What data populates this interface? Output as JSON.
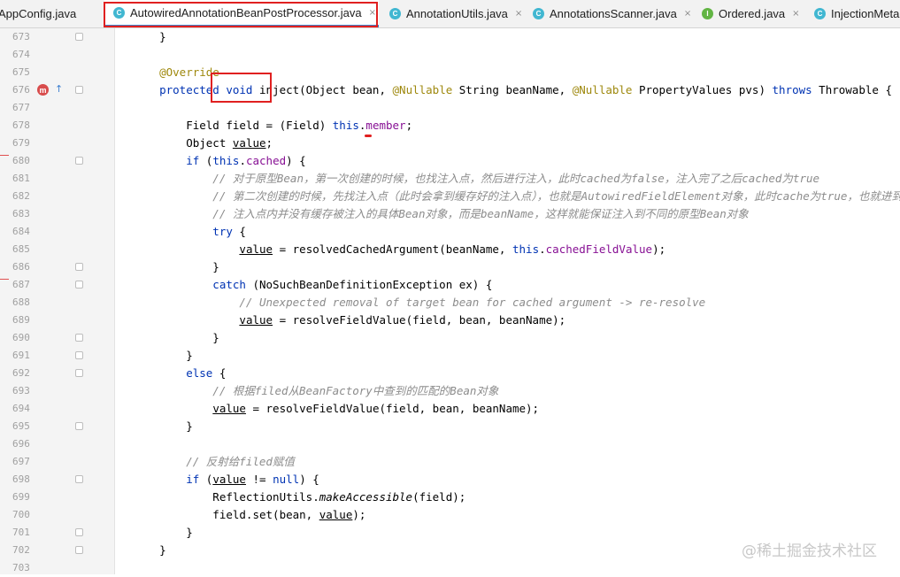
{
  "tabs": [
    {
      "label": "AppConfig.java",
      "icon": "class-icon",
      "active": false
    },
    {
      "label": "AutowiredAnnotationBeanPostProcessor.java",
      "icon": "class-icon",
      "active": true
    },
    {
      "label": "AnnotationUtils.java",
      "icon": "class-icon",
      "active": false
    },
    {
      "label": "AnnotationsScanner.java",
      "icon": "class-icon",
      "active": false
    },
    {
      "label": "Ordered.java",
      "icon": "interface-icon",
      "active": false
    },
    {
      "label": "InjectionMeta",
      "icon": "class-icon",
      "active": false
    }
  ],
  "icons": {
    "class_letter": "C",
    "interface_letter": "I",
    "override_letter": "m",
    "override_marker": "↑",
    "close": "×"
  },
  "lines": [
    {
      "num": "673",
      "segments": [
        [
          "",
          "    }"
        ]
      ]
    },
    {
      "num": "674",
      "segments": []
    },
    {
      "num": "675",
      "segments": [
        [
          "ann",
          "    @Override"
        ]
      ]
    },
    {
      "num": "676",
      "segments": [
        [
          "kw",
          "    protected void "
        ],
        [
          "",
          "inject(Object bean, "
        ],
        [
          "ann",
          "@Nullable"
        ],
        [
          "",
          " String beanName, "
        ],
        [
          "ann",
          "@Nullable"
        ],
        [
          "",
          " PropertyValues pvs) "
        ],
        [
          "kw",
          "throws"
        ],
        [
          "",
          " Throwable {"
        ]
      ]
    },
    {
      "num": "677",
      "segments": []
    },
    {
      "num": "678",
      "segments": [
        [
          "",
          "        Field field = (Field) "
        ],
        [
          "kw",
          "this"
        ],
        [
          "",
          "."
        ],
        [
          "fld",
          "member"
        ],
        [
          "",
          ";"
        ]
      ]
    },
    {
      "num": "679",
      "segments": [
        [
          "",
          "        Object "
        ],
        [
          "ul",
          "value"
        ],
        [
          "",
          ";"
        ]
      ]
    },
    {
      "num": "680",
      "segments": [
        [
          "kw",
          "        if"
        ],
        [
          "",
          " ("
        ],
        [
          "kw",
          "this"
        ],
        [
          "",
          "."
        ],
        [
          "fld",
          "cached"
        ],
        [
          "",
          ") {"
        ]
      ]
    },
    {
      "num": "681",
      "segments": [
        [
          "cm",
          "            // 对于原型Bean，第一次创建的时候，也找注入点，然后进行注入，此时cached为false，注入完了之后cached为true"
        ]
      ]
    },
    {
      "num": "682",
      "segments": [
        [
          "cm",
          "            // 第二次创建的时候，先找注入点（此时会拿到缓存好的注入点），也就是AutowiredFieldElement对象，此时cache为true，也就进到此处了"
        ]
      ]
    },
    {
      "num": "683",
      "segments": [
        [
          "cm",
          "            // 注入点内并没有缓存被注入的具体Bean对象，而是beanName，这样就能保证注入到不同的原型Bean对象"
        ]
      ]
    },
    {
      "num": "684",
      "segments": [
        [
          "kw",
          "            try"
        ],
        [
          "",
          " {"
        ]
      ]
    },
    {
      "num": "685",
      "segments": [
        [
          "",
          "                "
        ],
        [
          "ul",
          "value"
        ],
        [
          "",
          " = resolvedCachedArgument(beanName, "
        ],
        [
          "kw",
          "this"
        ],
        [
          "",
          "."
        ],
        [
          "fld",
          "cachedFieldValue"
        ],
        [
          "",
          ");"
        ]
      ]
    },
    {
      "num": "686",
      "segments": [
        [
          "",
          "            }"
        ]
      ]
    },
    {
      "num": "687",
      "segments": [
        [
          "kw",
          "            catch"
        ],
        [
          "",
          " (NoSuchBeanDefinitionException ex) {"
        ]
      ]
    },
    {
      "num": "688",
      "segments": [
        [
          "cm",
          "                // Unexpected removal of target bean for cached argument -> re-resolve"
        ]
      ]
    },
    {
      "num": "689",
      "segments": [
        [
          "",
          "                "
        ],
        [
          "ul",
          "value"
        ],
        [
          "",
          " = resolveFieldValue(field, bean, beanName);"
        ]
      ]
    },
    {
      "num": "690",
      "segments": [
        [
          "",
          "            }"
        ]
      ]
    },
    {
      "num": "691",
      "segments": [
        [
          "",
          "        }"
        ]
      ]
    },
    {
      "num": "692",
      "segments": [
        [
          "kw",
          "        else"
        ],
        [
          "",
          " {"
        ]
      ]
    },
    {
      "num": "693",
      "segments": [
        [
          "cm",
          "            // 根据filed从BeanFactory中查到的匹配的Bean对象"
        ]
      ]
    },
    {
      "num": "694",
      "segments": [
        [
          "",
          "            "
        ],
        [
          "ul",
          "value"
        ],
        [
          "",
          " = resolveFieldValue(field, bean, beanName);"
        ]
      ]
    },
    {
      "num": "695",
      "segments": [
        [
          "",
          "        }"
        ]
      ]
    },
    {
      "num": "696",
      "segments": []
    },
    {
      "num": "697",
      "segments": [
        [
          "cm",
          "        // 反射给filed赋值"
        ]
      ]
    },
    {
      "num": "698",
      "segments": [
        [
          "kw",
          "        if"
        ],
        [
          "",
          " ("
        ],
        [
          "ul",
          "value"
        ],
        [
          "",
          " != "
        ],
        [
          "kw",
          "null"
        ],
        [
          "",
          ") {"
        ]
      ]
    },
    {
      "num": "699",
      "segments": [
        [
          "",
          "            ReflectionUtils."
        ],
        [
          "it",
          "makeAccessible"
        ],
        [
          "",
          "(field);"
        ]
      ]
    },
    {
      "num": "700",
      "segments": [
        [
          "",
          "            field.set(bean, "
        ],
        [
          "ul",
          "value"
        ],
        [
          "",
          ");"
        ]
      ]
    },
    {
      "num": "701",
      "segments": [
        [
          "",
          "        }"
        ]
      ]
    },
    {
      "num": "702",
      "segments": [
        [
          "",
          "    }"
        ]
      ]
    },
    {
      "num": "703",
      "segments": []
    }
  ],
  "watermark": "@稀土掘金技术社区",
  "colors": {
    "keyword": "#0033b3",
    "annotation": "#9e880d",
    "field": "#871094",
    "comment": "#8c8c8c",
    "highlight_box": "#e02020",
    "active_tab_underline": "#4083c9"
  }
}
